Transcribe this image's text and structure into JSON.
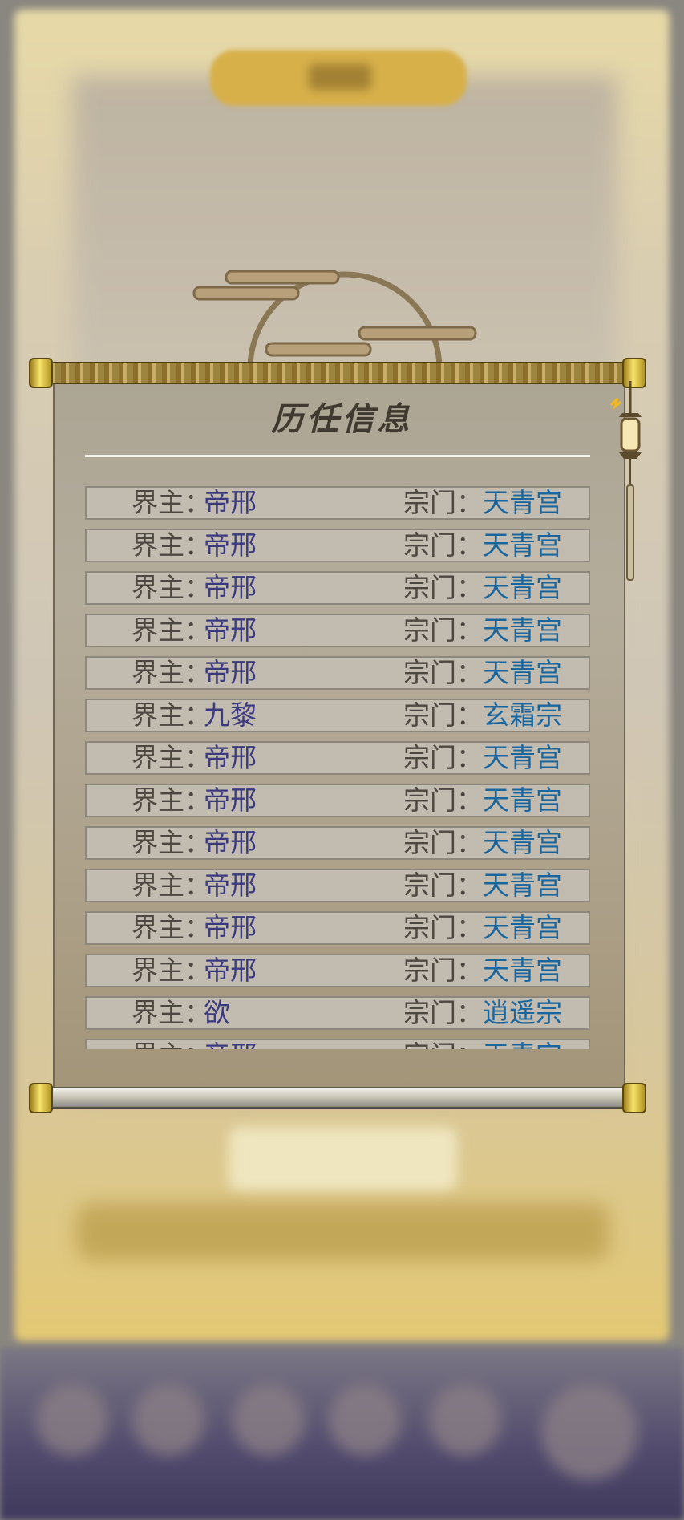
{
  "panel": {
    "title": "历任信息",
    "lord_label": "界主：",
    "sect_label": "宗门："
  },
  "records": [
    {
      "lord": "帝邢",
      "sect": "天青宫"
    },
    {
      "lord": "帝邢",
      "sect": "天青宫"
    },
    {
      "lord": "帝邢",
      "sect": "天青宫"
    },
    {
      "lord": "帝邢",
      "sect": "天青宫"
    },
    {
      "lord": "帝邢",
      "sect": "天青宫"
    },
    {
      "lord": "九黎",
      "sect": "玄霜宗"
    },
    {
      "lord": "帝邢",
      "sect": "天青宫"
    },
    {
      "lord": "帝邢",
      "sect": "天青宫"
    },
    {
      "lord": "帝邢",
      "sect": "天青宫"
    },
    {
      "lord": "帝邢",
      "sect": "天青宫"
    },
    {
      "lord": "帝邢",
      "sect": "天青宫"
    },
    {
      "lord": "帝邢",
      "sect": "天青宫"
    },
    {
      "lord": "欲",
      "sect": "逍遥宗"
    },
    {
      "lord": "帝邢",
      "sect": "天青宫"
    }
  ],
  "colors": {
    "lord_name": "#3c3a7e",
    "sect_name": "#1a67a0",
    "label": "#4c4740",
    "rod_gold": "#d7b04a"
  }
}
